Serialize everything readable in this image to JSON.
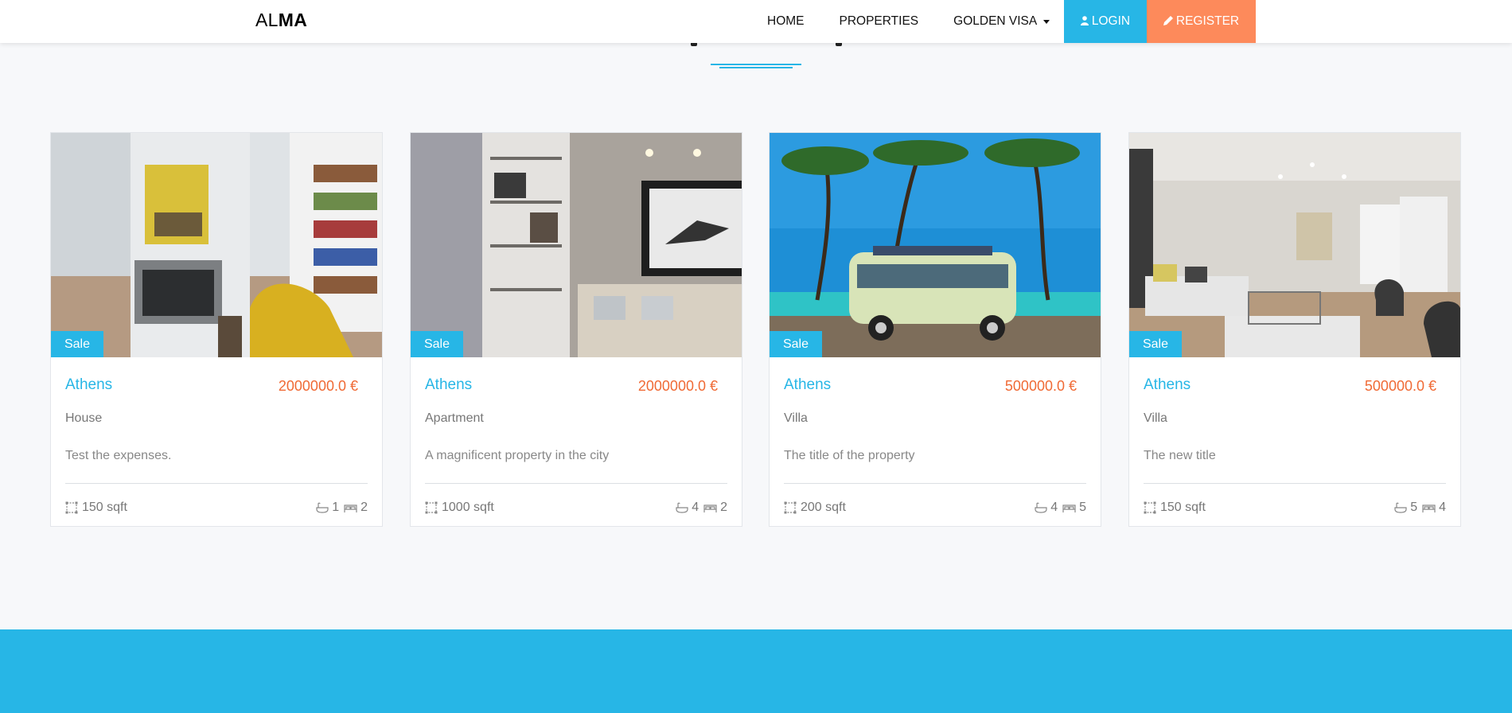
{
  "brand": {
    "light": "AL",
    "bold": "MA"
  },
  "nav": {
    "home": "HOME",
    "properties": "PROPERTIES",
    "golden_visa": "GOLDEN VISA",
    "login": "LOGIN",
    "register": "REGISTER"
  },
  "colors": {
    "accent": "#27b6e6",
    "price": "#f06a35",
    "register": "#fd8a5b"
  },
  "cards": [
    {
      "badge": "Sale",
      "city": "Athens",
      "price": "2000000.0 €",
      "type": "House",
      "title": "Test the expenses.",
      "area": "150 sqft",
      "baths": "1",
      "beds": "2",
      "image_icon": "living-room-fireplace-image"
    },
    {
      "badge": "Sale",
      "city": "Athens",
      "price": "2000000.0 €",
      "type": "Apartment",
      "title": "A magnificent property in the city",
      "area": "1000 sqft",
      "baths": "4",
      "beds": "2",
      "image_icon": "living-room-bookshelf-image"
    },
    {
      "badge": "Sale",
      "city": "Athens",
      "price": "500000.0 €",
      "type": "Villa",
      "title": "The title of the property",
      "area": "200 sqft",
      "baths": "4",
      "beds": "5",
      "image_icon": "beach-van-image"
    },
    {
      "badge": "Sale",
      "city": "Athens",
      "price": "500000.0 €",
      "type": "Villa",
      "title": "The new title",
      "area": "150 sqft",
      "baths": "5",
      "beds": "4",
      "image_icon": "bright-living-room-image"
    }
  ]
}
